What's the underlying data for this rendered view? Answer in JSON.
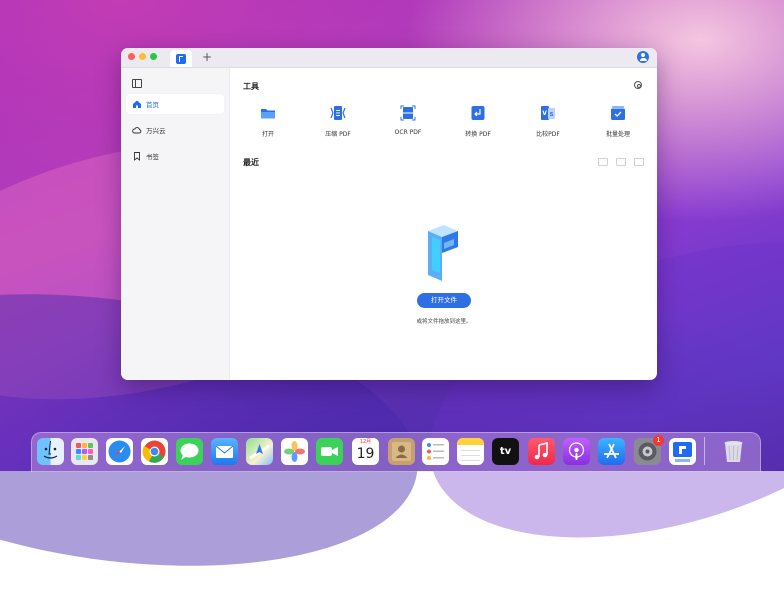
{
  "window": {
    "tab_add_label": "+"
  },
  "sidebar": {
    "items": [
      {
        "label": "首页",
        "icon": "home-icon",
        "active": true
      },
      {
        "label": "万兴云",
        "icon": "cloud-icon",
        "active": false
      },
      {
        "label": "书签",
        "icon": "bookmark-icon",
        "active": false
      }
    ]
  },
  "tools": {
    "title": "工具",
    "items": [
      {
        "label": "打开",
        "icon": "open-folder-icon"
      },
      {
        "label": "压缩 PDF",
        "icon": "compress-pdf-icon"
      },
      {
        "label": "OCR PDF",
        "icon": "ocr-pdf-icon"
      },
      {
        "label": "转换 PDF",
        "icon": "convert-pdf-icon"
      },
      {
        "label": "比较PDF",
        "icon": "compare-pdf-icon"
      },
      {
        "label": "批量处理",
        "icon": "batch-process-icon"
      }
    ]
  },
  "recent": {
    "title": "最近",
    "open_button": "打开文件",
    "hint": "或将文件拖放到这里。"
  },
  "dock": {
    "calendar_month": "12月",
    "calendar_day": "19",
    "settings_badge": "1",
    "tv_label": "tv",
    "items": [
      "finder",
      "launchpad",
      "safari",
      "chrome",
      "messages",
      "mail",
      "maps",
      "photos",
      "facetime",
      "calendar",
      "contacts",
      "reminders",
      "notes",
      "apple-tv",
      "music",
      "podcasts",
      "app-store",
      "system-preferences",
      "pdfelement",
      "trash"
    ]
  },
  "colors": {
    "accent": "#2f6fe4",
    "sidebar_bg": "#f5f5f7"
  }
}
